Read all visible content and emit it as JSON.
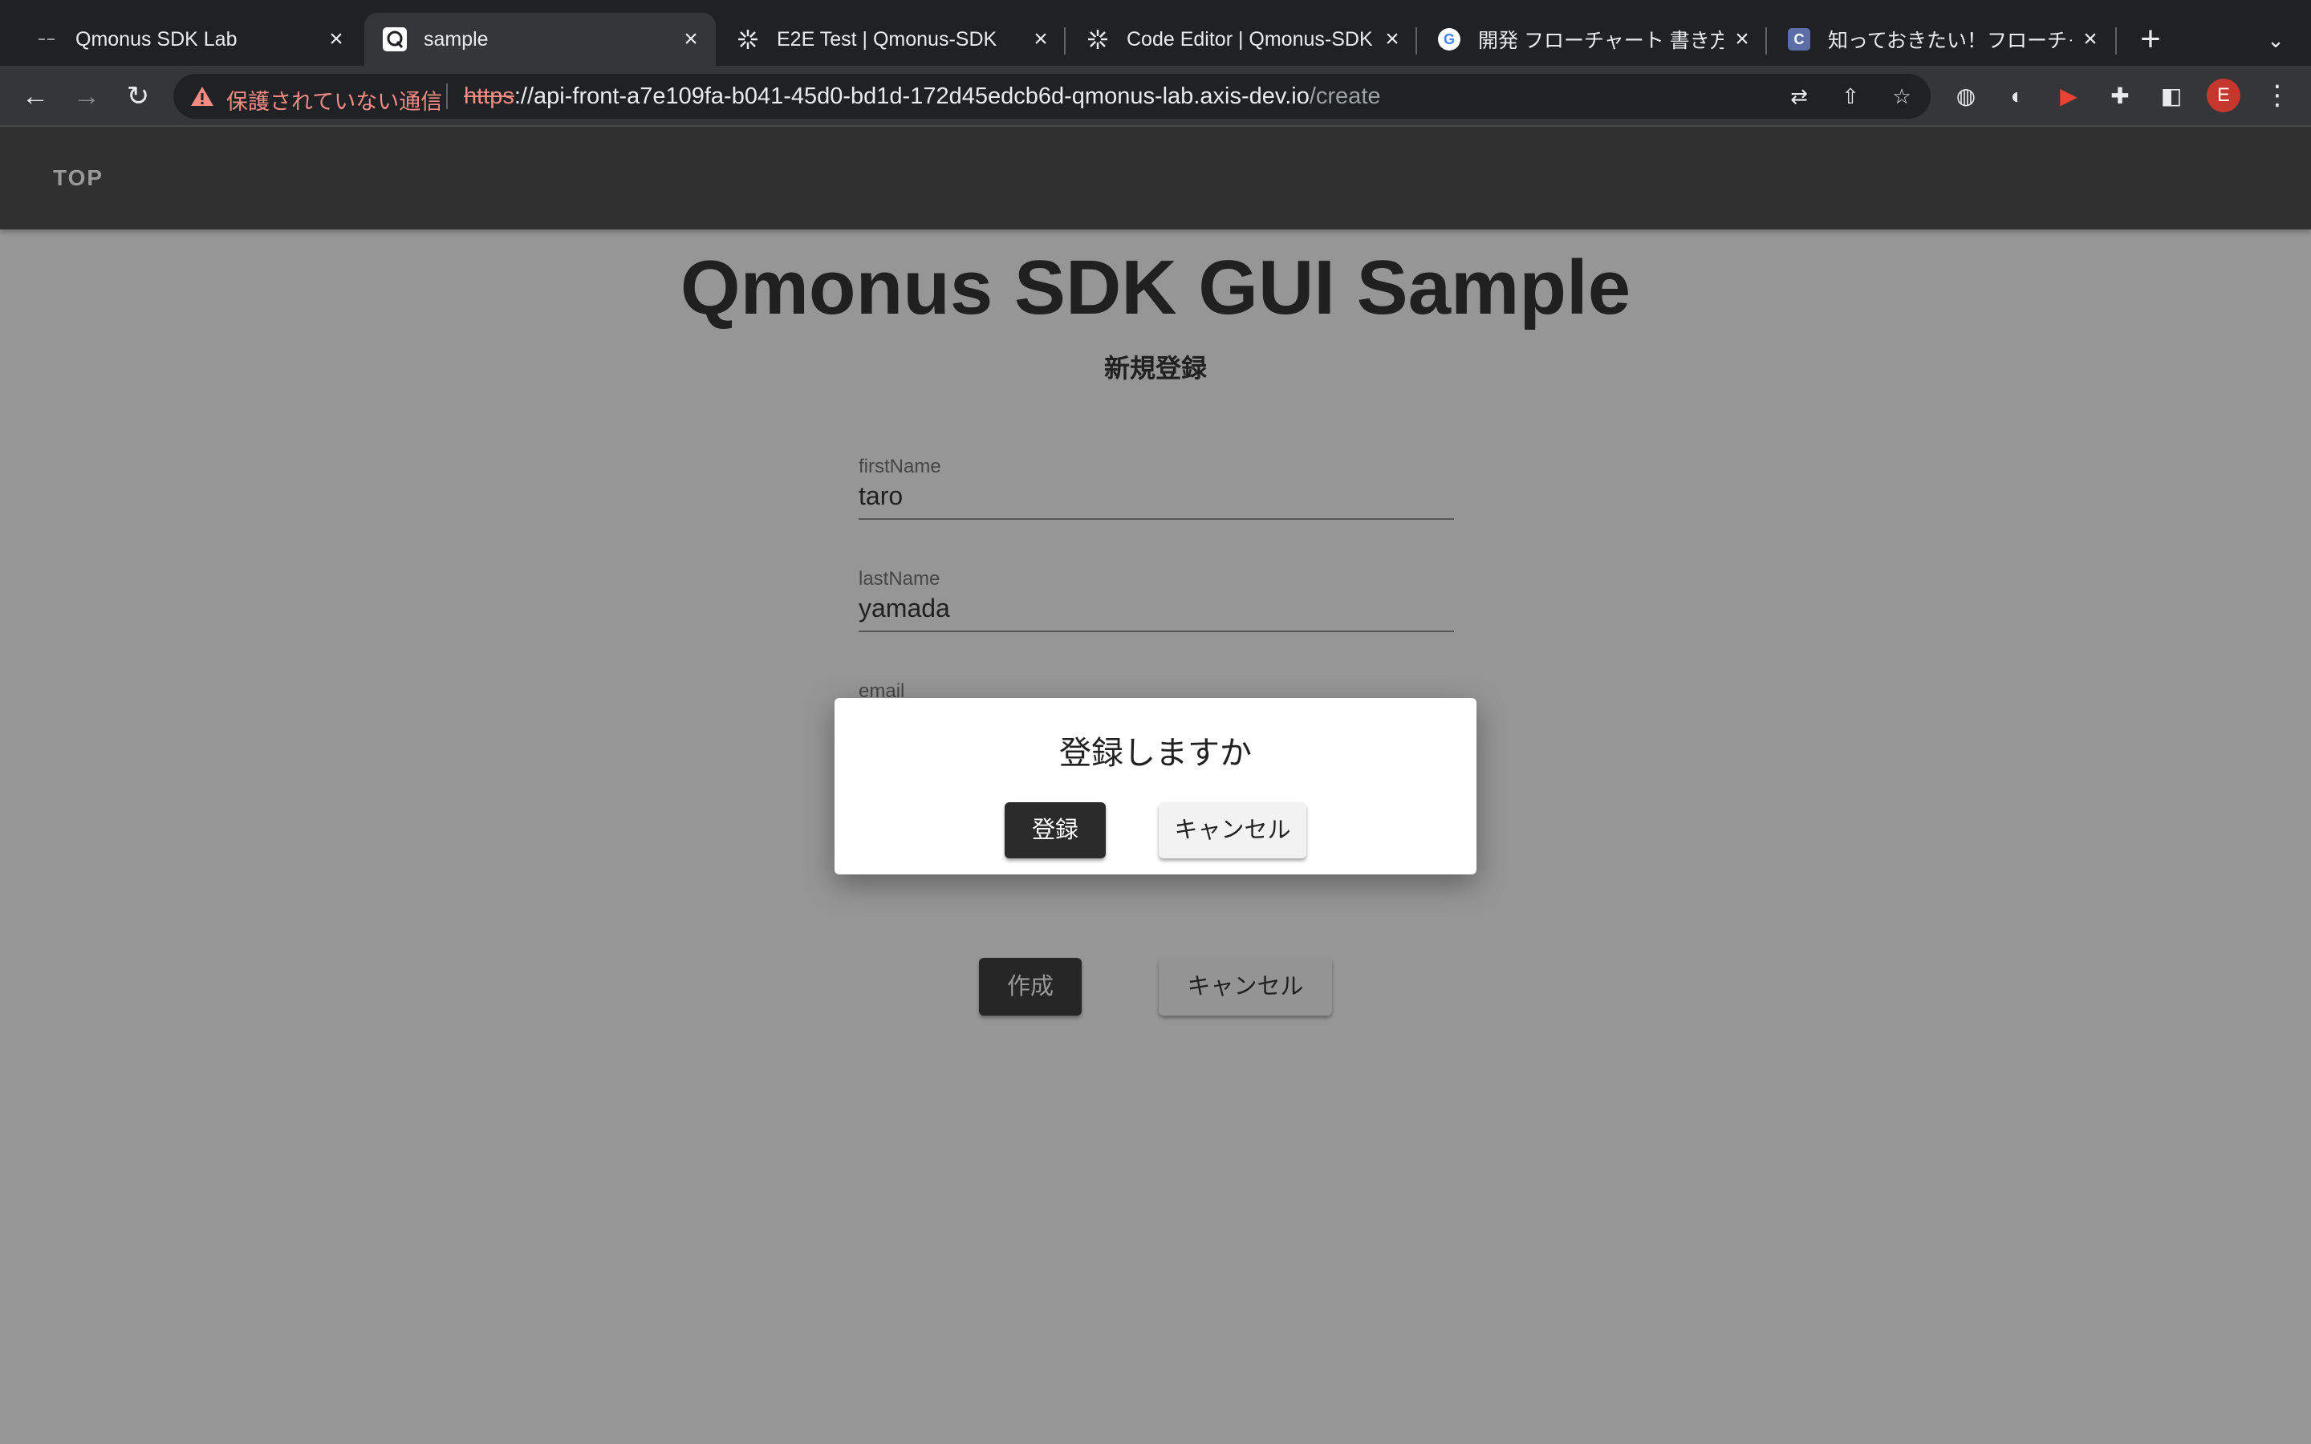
{
  "browser": {
    "tabs": [
      {
        "title": "Qmonus SDK Lab",
        "icon": "qmonus-lab-icon",
        "active": false
      },
      {
        "title": "sample",
        "icon": "qmonus-q-icon",
        "active": true
      },
      {
        "title": "E2E Test | Qmonus-SDK",
        "icon": "qmonus-sdk-icon",
        "active": false
      },
      {
        "title": "Code Editor | Qmonus-SDK",
        "icon": "qmonus-sdk-icon",
        "active": false
      },
      {
        "title": "開発 フローチャート 書き方 - ",
        "icon": "google-icon",
        "active": false
      },
      {
        "title": "知っておきたい！フローチャ",
        "icon": "c-icon",
        "active": false
      }
    ],
    "address_bar": {
      "security_label": "保護されていない通信",
      "url_scheme": "https",
      "url_sep": "://",
      "url_host": "api-front-a7e109fa-b041-45d0-bd1d-172d45edcb6d-qmonus-lab.axis-dev.io",
      "url_path": "/create"
    },
    "profile_initial": "E"
  },
  "app": {
    "nav_top": "TOP",
    "title": "Qmonus SDK GUI Sample",
    "subtitle": "新規登録",
    "fields": {
      "first_name": {
        "label": "firstName",
        "value": "taro"
      },
      "last_name": {
        "label": "lastName",
        "value": "yamada"
      },
      "email": {
        "label": "email",
        "value": ""
      }
    },
    "create_button": "作成",
    "cancel_button": "キャンセル"
  },
  "dialog": {
    "title": "登録しますか",
    "confirm_button": "登録",
    "cancel_button": "キャンセル"
  }
}
